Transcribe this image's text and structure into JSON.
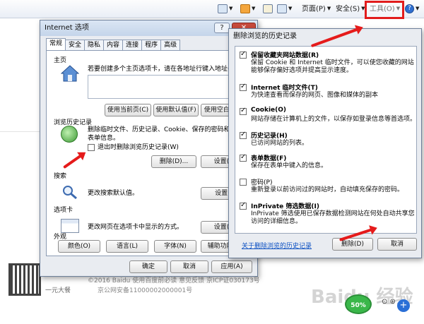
{
  "toolbar": {
    "page": "页面(P)",
    "safety": "安全(S)",
    "tools": "工具(O)",
    "help": "?"
  },
  "background": {
    "footer_line1": "©2016 Baidu 使用百度前必读 意见反馈 京ICP证030173号",
    "footer_line2": "京公网安备11000002000001号",
    "qr_caption": "一元大餐",
    "watermark": "Baidu 经验",
    "badge": "50%",
    "side_tools": "⊙ ⊛"
  },
  "options": {
    "title": "Internet 选项",
    "help_button": "?",
    "close_button": "✕",
    "tabs": [
      "常规",
      "安全",
      "隐私",
      "内容",
      "连接",
      "程序",
      "高级"
    ],
    "homepage": {
      "title": "主页",
      "desc": "若要创建多个主页选项卡，请在各地址行键入地址(R)。",
      "use_current": "使用当前页(C)",
      "use_default": "使用默认值(F)",
      "use_blank": "使用空白页(B)"
    },
    "history": {
      "title": "浏览历史记录",
      "desc": "删除临时文件、历史记录、Cookie、保存的密码和网页表单信息。",
      "exit_checkbox": "退出时删除浏览历史记录(W)",
      "delete_button": "删除(D)...",
      "settings_button": "设置(S)"
    },
    "search": {
      "title": "搜索",
      "desc": "更改搜索默认值。",
      "settings_button": "设置(I)"
    },
    "tabsec": {
      "title": "选项卡",
      "desc": "更改网页在选项卡中显示的方式。",
      "settings_button": "设置(T)"
    },
    "appearance": {
      "title": "外观",
      "colors": "颜色(O)",
      "languages": "语言(L)",
      "fonts": "字体(N)",
      "accessibility": "辅助功能(E)"
    },
    "ok": "确定",
    "cancel": "取消",
    "apply": "应用(A)"
  },
  "delete_history": {
    "title": "删除浏览的历史记录",
    "items": [
      {
        "title": "保留收藏夹网站数据(R)",
        "desc": "保留 Cookie 和 Internet 临时文件，可以使您收藏的网站能够保存偏好选项并提高显示速度。",
        "checked": true
      },
      {
        "title": "Internet 临时文件(T)",
        "desc": "为快速查看而保存的网页、图像和媒体的副本",
        "checked": true
      },
      {
        "title": "Cookie(O)",
        "desc": "网站存储在计算机上的文件，以保存如登录信息等首选项。",
        "checked": true
      },
      {
        "title": "历史记录(H)",
        "desc": "已访问网站的列表。",
        "checked": true
      },
      {
        "title": "表单数据(F)",
        "desc": "保存在表单中键入的信息。",
        "checked": true
      },
      {
        "title": "密码(P)",
        "desc": "重新登录以前访问过的网站时，自动填充保存的密码。",
        "checked": false
      },
      {
        "title": "InPrivate 筛选数据(I)",
        "desc": "InPrivate 筛选使用已保存数据检测网站在何处自动共享您访问的详细信息。",
        "checked": true
      }
    ],
    "link": "关于删除浏览的历史记录",
    "delete_button": "删除(D)",
    "cancel_button": "取消"
  },
  "colors": {
    "annotation_red": "#e51b1b",
    "link_blue": "#0a4fc2"
  }
}
